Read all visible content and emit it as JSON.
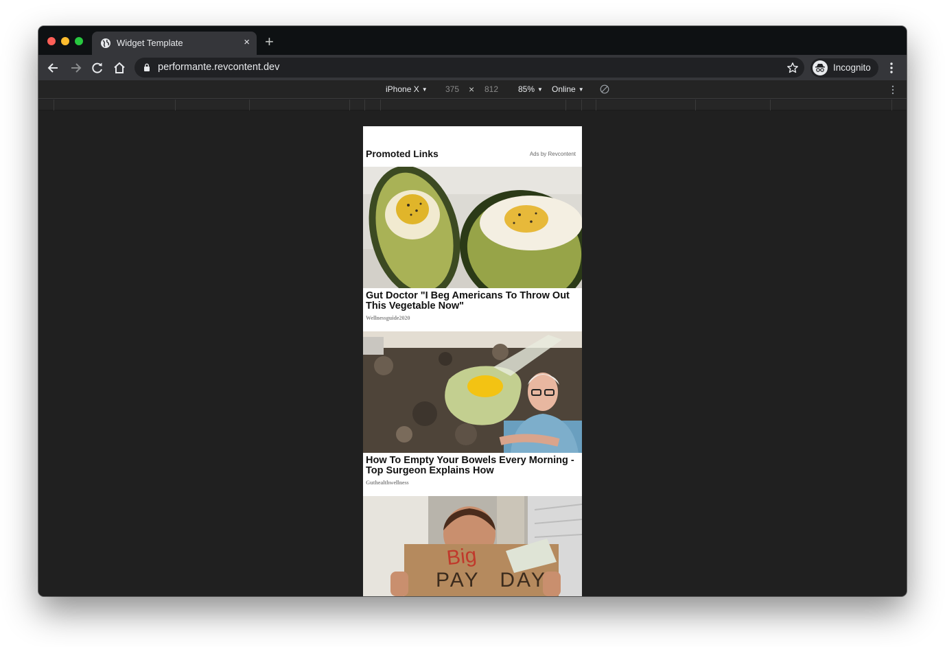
{
  "browser": {
    "tab": {
      "title": "Widget Template",
      "close_label": "×"
    },
    "new_tab_label": "+",
    "url": "performante.revcontent.dev",
    "profile_label": "Incognito"
  },
  "devtools": {
    "device": "iPhone X",
    "width": "375",
    "separator": "×",
    "height": "812",
    "zoom": "85%",
    "network": "Online",
    "caret": "▼"
  },
  "widget": {
    "title": "Promoted Links",
    "ads_label": "Ads by Revcontent",
    "cards": [
      {
        "headline": "Gut Doctor \"I Beg Americans To Throw Out This Vegetable Now\"",
        "source": "Wellnessguide2020",
        "image": "avocado-eggs-photo"
      },
      {
        "headline": "How To Empty Your Bowels Every Morning - Top Surgeon Explains How",
        "source": "Guthealthwellness",
        "image": "egg-in-bag-surgeon-photo"
      },
      {
        "headline": "",
        "source": "",
        "image": "big-pay-day-sign-photo",
        "sign_text_top": "Big",
        "sign_text_bottom": "PAY DAY"
      }
    ]
  },
  "colors": {
    "tabstrip": "#0e1113",
    "toolbar": "#35363a",
    "viewport": "#202020",
    "traffic_red": "#fe5f57",
    "traffic_yellow": "#febc2e",
    "traffic_green": "#28c840"
  }
}
